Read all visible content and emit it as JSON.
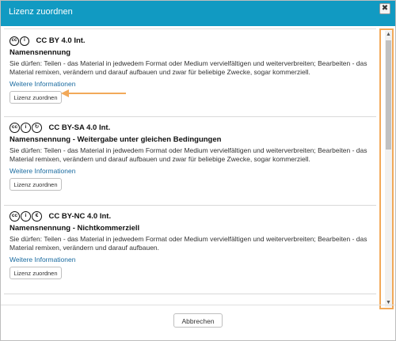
{
  "dialog": {
    "title": "Lizenz zuordnen",
    "close_glyph": "✖",
    "cancel_label": "Abbrechen"
  },
  "licenses": [
    {
      "code": "CC BY 4.0 Int.",
      "icons": [
        "cc-icon",
        "by-icon"
      ],
      "name": "Namensnennung",
      "description": "Sie dürfen: Teilen - das Material in jedwedem Format oder Medium vervielfältigen und weiterverbreiten; Bearbeiten - das Material remixen, verändern und darauf aufbauen und zwar für beliebige Zwecke, sogar kommerziell.",
      "more_label": "Weitere Informationen",
      "assign_label": "Lizenz zuordnen"
    },
    {
      "code": "CC BY-SA 4.0 Int.",
      "icons": [
        "cc-icon",
        "by-icon",
        "sa-icon"
      ],
      "name": "Namensnennung - Weitergabe unter gleichen Bedingungen",
      "description": "Sie dürfen: Teilen - das Material in jedwedem Format oder Medium vervielfältigen und weiterverbreiten; Bearbeiten - das Material remixen, verändern und darauf aufbauen und zwar für beliebige Zwecke, sogar kommerziell.",
      "more_label": "Weitere Informationen",
      "assign_label": "Lizenz zuordnen"
    },
    {
      "code": "CC BY-NC 4.0 Int.",
      "icons": [
        "cc-icon",
        "by-icon",
        "nc-icon"
      ],
      "name": "Namensnennung - Nichtkommerziell",
      "description": "Sie dürfen: Teilen - das Material in jedwedem Format oder Medium vervielfältigen und weiterverbreiten; Bearbeiten - das Material remixen, verändern und darauf aufbauen.",
      "more_label": "Weitere Informationen",
      "assign_label": "Lizenz zuordnen"
    }
  ],
  "scrollbar": {
    "up_glyph": "▲",
    "down_glyph": "▼"
  },
  "colors": {
    "titlebar": "#119ac2",
    "highlight": "#f2a959",
    "link": "#1a6ba0"
  }
}
